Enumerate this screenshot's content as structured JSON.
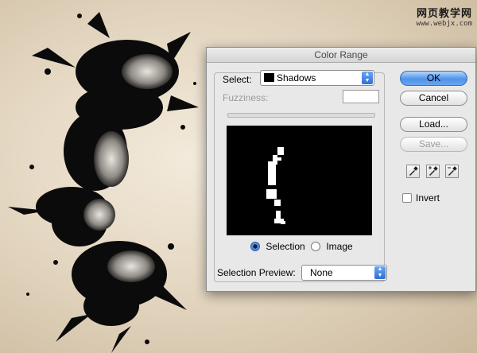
{
  "watermark": {
    "line1": "网页教学网",
    "line2": "www.webjx.com"
  },
  "dialog": {
    "title": "Color Range",
    "select_label": "Select:",
    "select_value": "Shadows",
    "fuzziness_label": "Fuzziness:",
    "fuzziness_value": "",
    "radio_selection": "Selection",
    "radio_image": "Image",
    "radio_selected": "Selection",
    "preview_label": "Selection Preview:",
    "preview_value": "None",
    "invert_label": "Invert",
    "invert_checked": false
  },
  "buttons": {
    "ok": "OK",
    "cancel": "Cancel",
    "load": "Load...",
    "save": "Save..."
  },
  "colors": {
    "accent": "#3a7fe0",
    "preview_bg": "#000000"
  },
  "icons": [
    "eyedropper-icon",
    "eyedropper-plus-icon",
    "eyedropper-minus-icon"
  ]
}
